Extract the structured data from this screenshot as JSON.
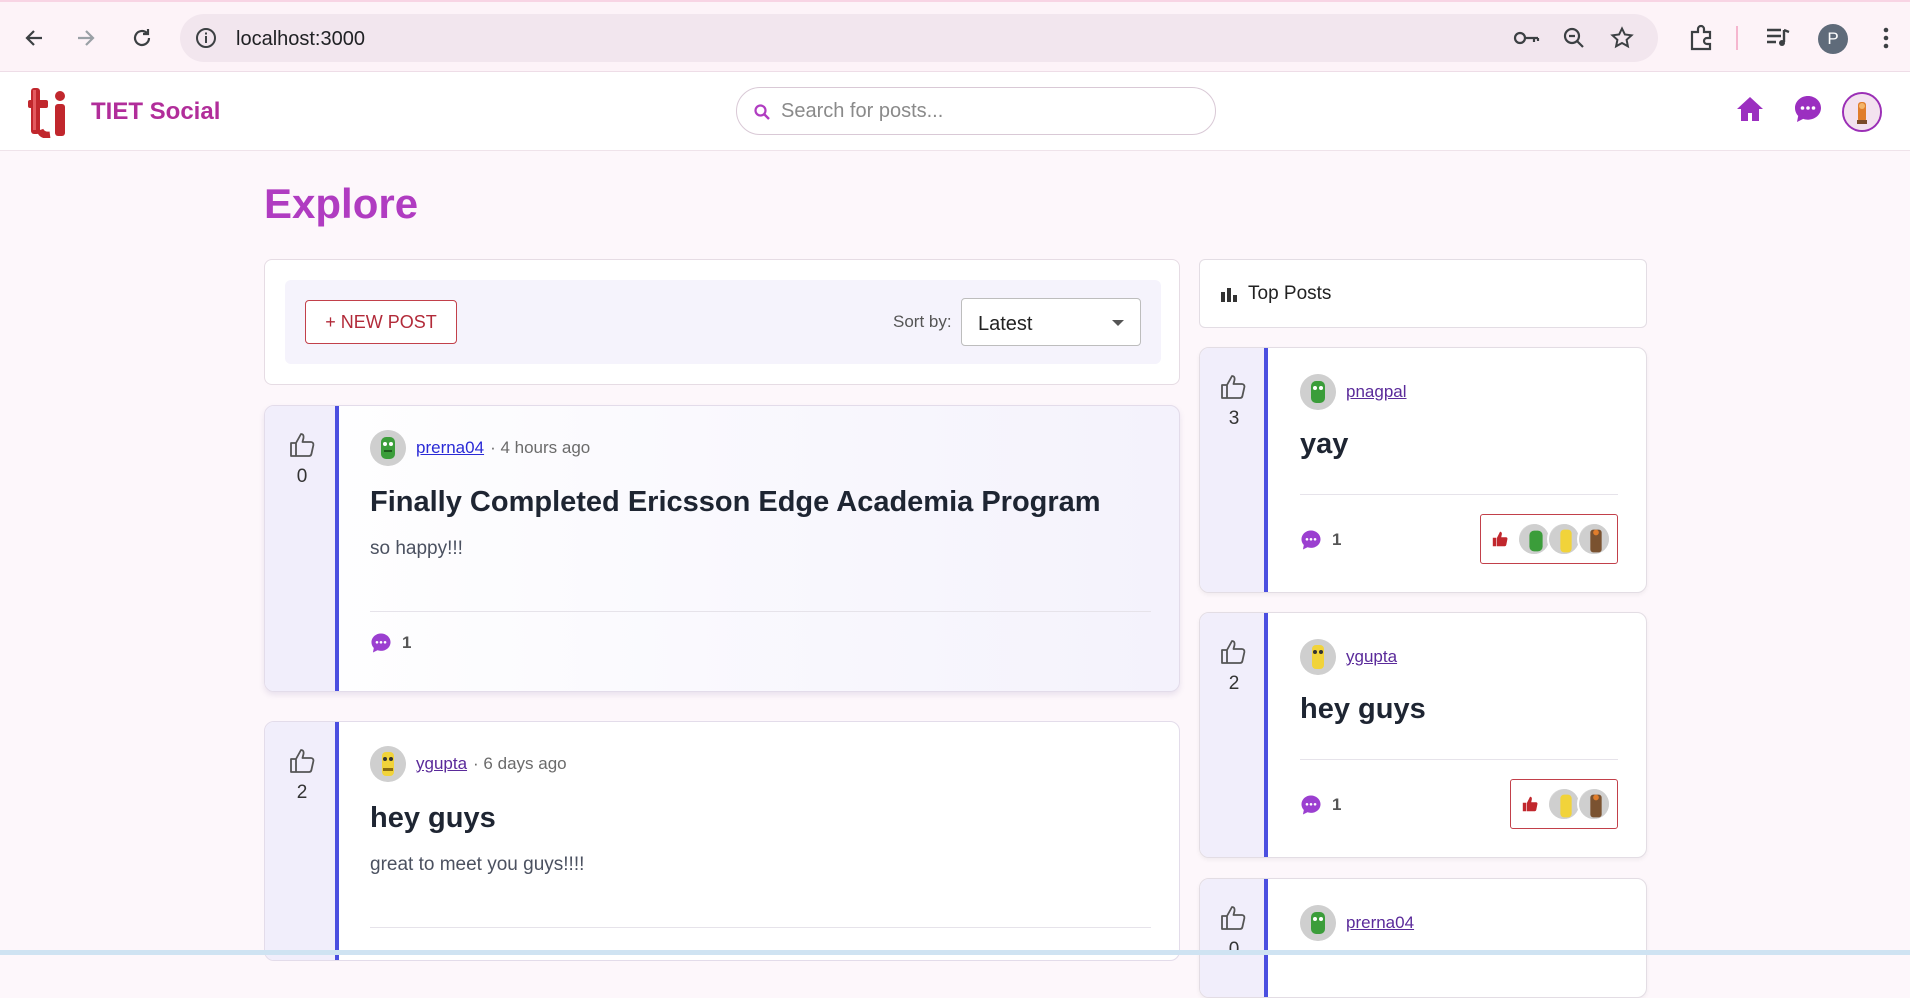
{
  "browser": {
    "url": "localhost:3000",
    "profile_initial": "P"
  },
  "app": {
    "brand": "TIET Social",
    "search_placeholder": "Search for posts...",
    "accent": "#b03cc1"
  },
  "page": {
    "title": "Explore",
    "new_post_label": "+ NEW POST",
    "sort_label": "Sort by:",
    "sort_value": "Latest"
  },
  "posts": [
    {
      "votes": "0",
      "user": "prerna04",
      "time": "· 4 hours ago",
      "title": "Finally Completed Ericsson Edge Academia Program",
      "body": "so happy!!!",
      "comments": "1"
    },
    {
      "votes": "2",
      "user": "ygupta",
      "time": "· 6 days ago",
      "title": "hey guys",
      "body": "great to meet you guys!!!!",
      "comments": ""
    }
  ],
  "top_posts": {
    "header": "Top Posts",
    "items": [
      {
        "votes": "3",
        "user": "pnagpal",
        "title": "yay",
        "comments": "1"
      },
      {
        "votes": "2",
        "user": "ygupta",
        "title": "hey guys",
        "comments": "1"
      },
      {
        "votes": "0",
        "user": "prerna04",
        "title": "",
        "comments": ""
      }
    ]
  }
}
